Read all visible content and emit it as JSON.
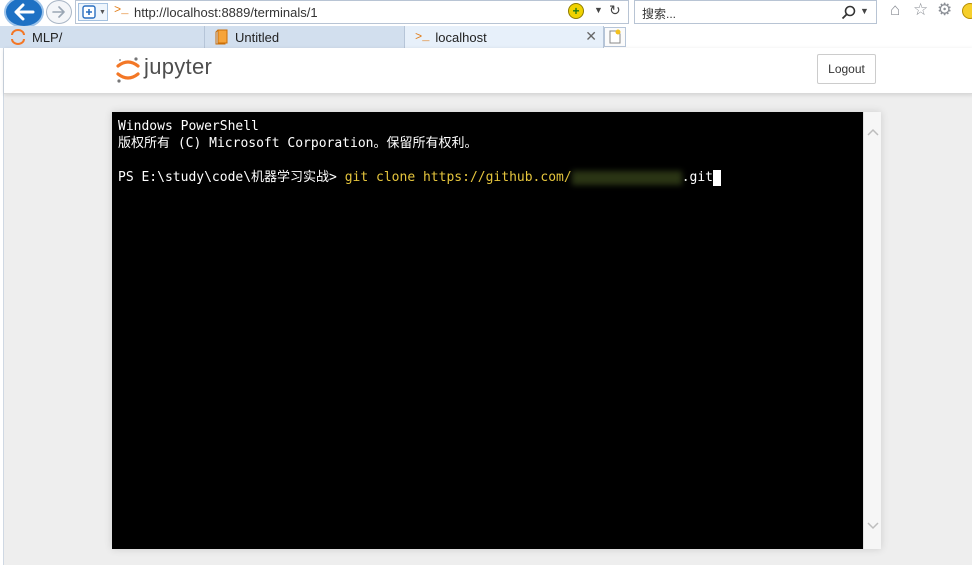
{
  "browser": {
    "address_prompt": ">_",
    "url": "http://localhost:8889/terminals/1",
    "search_placeholder": "搜索...",
    "tabs": [
      {
        "label": "MLP/"
      },
      {
        "label": "Untitled"
      },
      {
        "label": "localhost",
        "active": true
      }
    ],
    "icons": [
      "back-arrow-icon",
      "forward-arrow-icon",
      "site-identity-icon",
      "compatibility-icon",
      "refresh-icon",
      "search-icon",
      "home-icon",
      "favorites-star-icon",
      "settings-gear-icon",
      "feedback-smiley-icon",
      "new-tab-icon"
    ]
  },
  "jupyter": {
    "logo_text": "jupyter",
    "logout_label": "Logout"
  },
  "terminal": {
    "line1": "Windows PowerShell",
    "line2": "版权所有 (C) Microsoft Corporation。保留所有权利。",
    "prompt": "PS E:\\study\\code\\机器学习实战> ",
    "command": "git clone https://github.com/",
    "command_suffix": ".git"
  },
  "colors": {
    "accent_orange": "#f37726",
    "terminal_bg": "#000000",
    "command_yellow": "#e5c53d",
    "tab_bg": "#d2dfee"
  }
}
